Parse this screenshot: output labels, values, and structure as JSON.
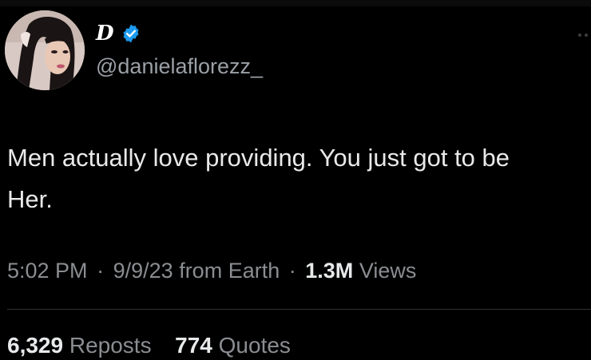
{
  "tweet": {
    "author": {
      "display_name": "D",
      "handle": "@danielaflorezz_",
      "verified": true,
      "verified_color": "#1d9bf0"
    },
    "text_lines": [
      "Men actually love providing. You just got to be",
      "Her."
    ],
    "meta": {
      "time": "5:02 PM",
      "separator": "·",
      "date": "9/9/23",
      "source": "from Earth",
      "views_count": "1.3M",
      "views_label": "Views"
    },
    "stats": {
      "reposts_count": "6,329",
      "reposts_label": "Reposts",
      "quotes_count": "774",
      "quotes_label": "Quotes"
    }
  },
  "icons": {
    "verified": "verified-badge-icon",
    "more": "more-options-icon"
  }
}
